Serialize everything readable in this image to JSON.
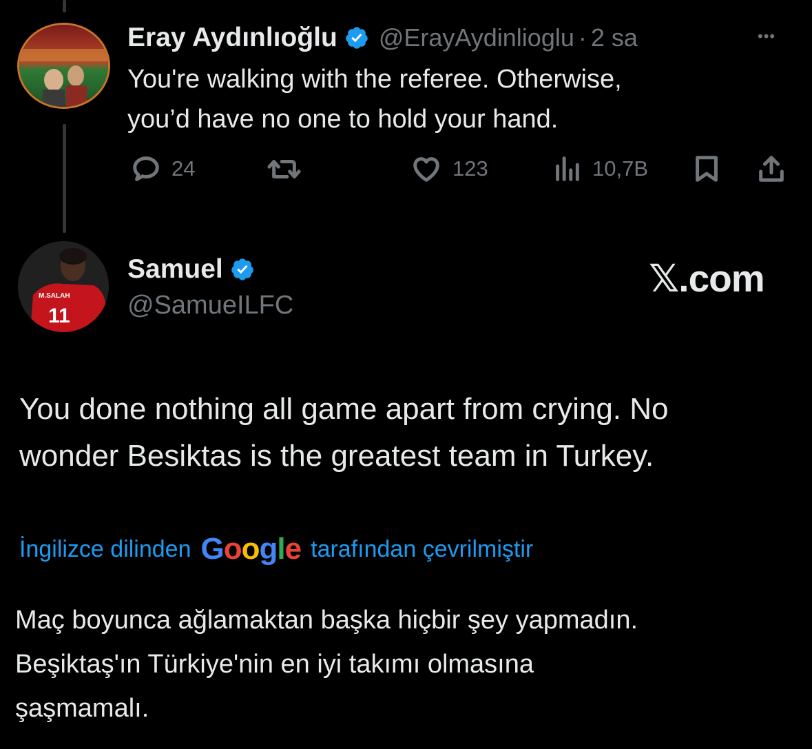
{
  "reply_tweet": {
    "author_name": "Eray Aydınlıoğlu",
    "handle": "@ErayAydinlioglu",
    "separator": "·",
    "time": "2 sa",
    "more_label": "•••",
    "text_line1": "You're walking with the referee. Otherwise,",
    "text_line2": "you’d have no one to hold your hand.",
    "replies": "24",
    "likes": "123",
    "views": "10,7B",
    "icons": [
      "reply-icon",
      "retweet-icon",
      "like-icon",
      "views-icon",
      "bookmark-icon",
      "share-icon"
    ]
  },
  "quoted_tweet": {
    "author_name": "Samuel",
    "handle": "@SamueILFC",
    "jersey_name": "M.SALAH",
    "jersey_number": "11",
    "brand": "𝕏.com",
    "text_line1": "You done nothing all game apart from crying. No",
    "text_line2": "wonder Besiktas is the greatest team in Turkey."
  },
  "translation": {
    "prefix": "İngilizce dilinden",
    "provider": "Google",
    "suffix": "tarafından çevrilmiştir",
    "text_line1": "Maç boyunca ağlamaktan başka hiçbir şey yapmadın.",
    "text_line2": "Beşiktaş'ın Türkiye'nin en iyi takımı olmasına",
    "text_line3": "şaşmamalı."
  },
  "colors": {
    "background": "#000000",
    "text_primary": "#e7e9ea",
    "text_secondary": "#71767b",
    "accent_blue": "#1d9bf0",
    "verified_blue": "#1d9bf0",
    "google_blue": "#4285f4",
    "google_red": "#ea4335",
    "google_yellow": "#fbbc05",
    "google_green": "#34a853"
  }
}
